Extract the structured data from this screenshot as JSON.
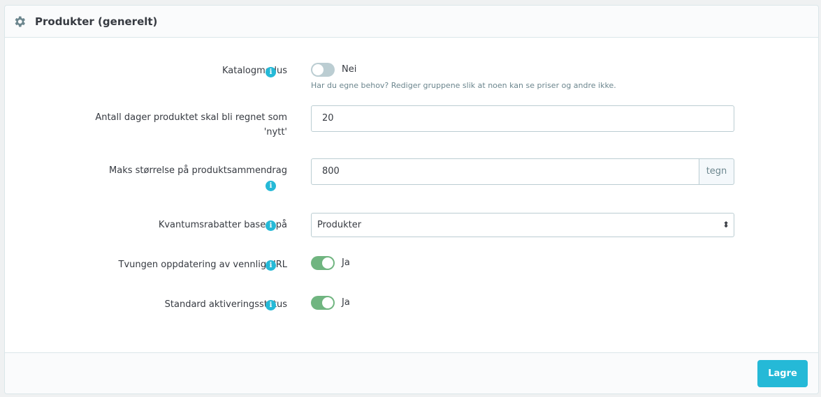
{
  "panel": {
    "title": "Produkter (generelt)",
    "icon": "gear-icon"
  },
  "fields": {
    "catalog_mode": {
      "label": "Katalogmodus",
      "state_label": "Nei",
      "enabled": false,
      "help": "Har du egne behov? Rediger gruppene slik at noen kan se priser og andre ikke."
    },
    "new_days": {
      "label_line1": "Antall dager produktet skal bli regnet som",
      "label_line2": "'nytt'",
      "value": "20"
    },
    "summary_size": {
      "label": "Maks størrelse på produktsammendrag",
      "value": "800",
      "unit": "tegn"
    },
    "quantity_discount": {
      "label": "Kvantumsrabatter basert på",
      "selected": "Produkter"
    },
    "force_friendly_url": {
      "label": "Tvungen oppdatering av vennlig URL",
      "state_label": "Ja",
      "enabled": true
    },
    "default_activation": {
      "label": "Standard aktiveringsstatus",
      "state_label": "Ja",
      "enabled": true
    }
  },
  "footer": {
    "save_label": "Lagre"
  },
  "colors": {
    "accent": "#25b9d7",
    "switch_on": "#70b580",
    "switch_off": "#bbcdd2"
  }
}
